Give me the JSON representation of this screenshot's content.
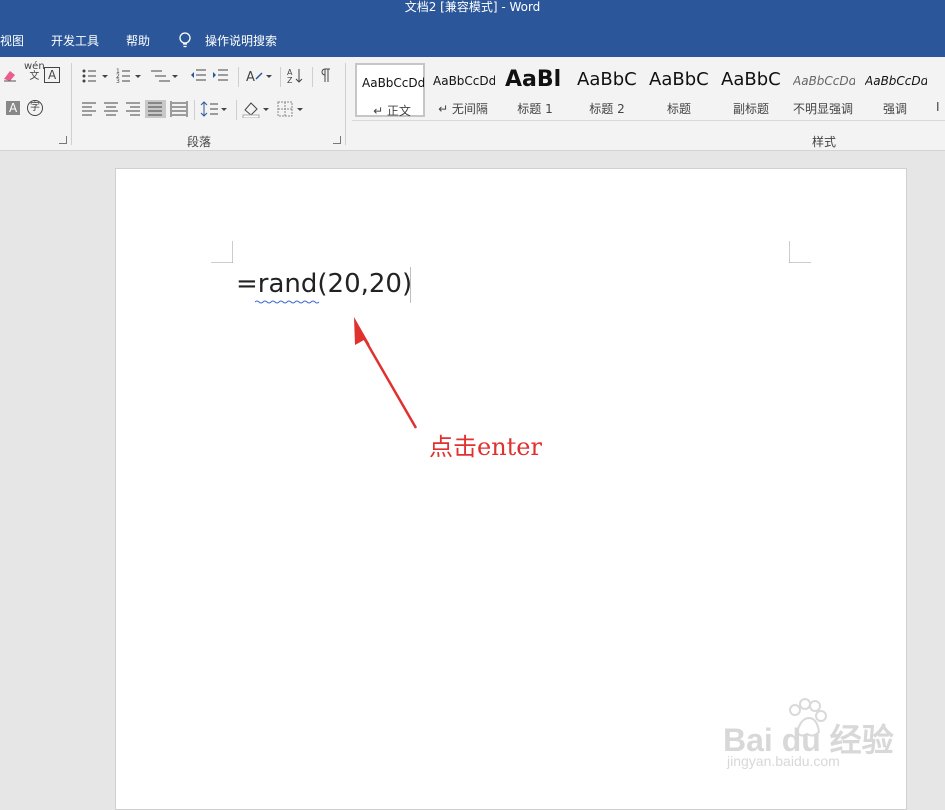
{
  "window": {
    "title": "文档2 [兼容模式]  -  Word"
  },
  "menu": {
    "items": [
      "视图",
      "开发工具",
      "帮助"
    ],
    "search_label": "操作说明搜索"
  },
  "ribbon": {
    "groups": {
      "paragraph": "段落",
      "styles": "样式"
    },
    "font_glyphs": {
      "phonetic": "wén\n文",
      "char_border": "A",
      "shade": "A",
      "enclose": "字"
    },
    "styles": [
      {
        "preview": "AaBbCcDd",
        "name": "↵ 正文",
        "selected": true
      },
      {
        "preview": "AaBbCcDd",
        "name": "↵ 无间隔"
      },
      {
        "preview": "AaBl",
        "name": "标题 1"
      },
      {
        "preview": "AaBbC",
        "name": "标题 2"
      },
      {
        "preview": "AaBbC",
        "name": "标题"
      },
      {
        "preview": "AaBbC",
        "name": "副标题"
      },
      {
        "preview": "AaBbCcDd",
        "name": "不明显强调"
      },
      {
        "preview": "AaBbCcDd",
        "name": "强调"
      }
    ]
  },
  "document": {
    "text": "=rand(20,20)",
    "annotation": "点击enter",
    "annotation_color": "#e0312f"
  },
  "watermark": {
    "brand": "Bai du 经验",
    "url": "jingyan.baidu.com"
  },
  "colors": {
    "word_blue": "#2b579a",
    "ribbon_bg": "#f3f3f3"
  }
}
